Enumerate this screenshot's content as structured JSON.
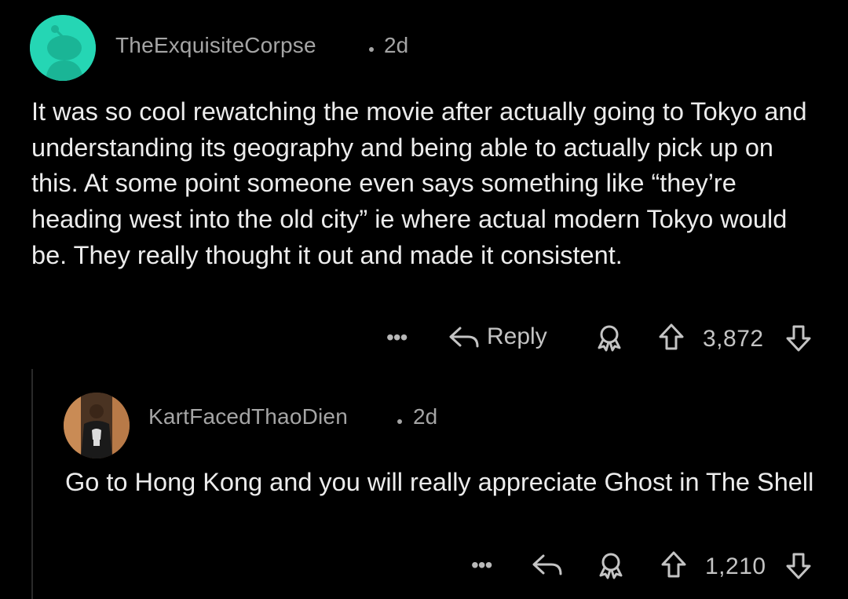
{
  "comments": [
    {
      "username": "TheExquisiteCorpse",
      "age": "2d",
      "body": "It was so cool rewatching the movie after actually going to Tokyo and understanding its geography and being able to actually pick up on this. At some point someone even says something like “they’re heading west into the old city” ie where actual modern Tokyo would be. They really thought it out and made it consistent.",
      "reply_label": "Reply",
      "votes": "3,872",
      "avatar_icon": "snoo-avatar-icon",
      "avatar_color": "#25d6b4"
    },
    {
      "username": "KartFacedThaoDien",
      "age": "2d",
      "body": "Go to Hong Kong and you will really appreciate Ghost in The Shell",
      "votes": "1,210",
      "avatar_icon": "user-photo-avatar"
    }
  ],
  "icons": {
    "more": "ellipsis-icon",
    "reply": "reply-arrow-icon",
    "award": "award-icon",
    "upvote": "upvote-arrow-icon",
    "downvote": "downvote-arrow-icon"
  },
  "theme": {
    "background": "#000000",
    "meta_text": "#a5a5a5",
    "body_text": "#ececec"
  }
}
